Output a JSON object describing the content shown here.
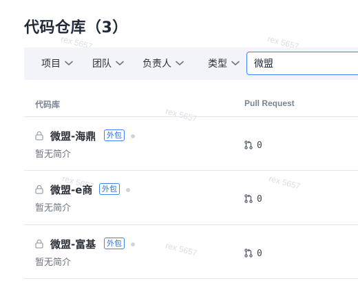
{
  "page": {
    "title": "代码仓库（3）"
  },
  "filters": {
    "items": [
      {
        "label": "项目"
      },
      {
        "label": "团队"
      },
      {
        "label": "负责人"
      },
      {
        "label": "类型"
      }
    ],
    "search_value": "微盟"
  },
  "table": {
    "columns": [
      "代码库",
      "Pull Request"
    ],
    "rows": [
      {
        "name": "微盟-海鼎",
        "tag": "外包",
        "description": "暂无简介",
        "pr_count": "0"
      },
      {
        "name": "微盟-e商",
        "tag": "外包",
        "description": "暂无简介",
        "pr_count": "0"
      },
      {
        "name": "微盟-富基",
        "tag": "外包",
        "description": "暂无简介",
        "pr_count": "0"
      }
    ]
  },
  "watermark": "rex 5657",
  "colors": {
    "accent": "#3b82f6",
    "filter_bar_bg": "#f2f4f7",
    "tag_text": "#2f6fde"
  },
  "icons": {
    "lock": "lock-icon",
    "chevron": "chevron-down-icon",
    "pull_request": "pull-request-icon"
  }
}
